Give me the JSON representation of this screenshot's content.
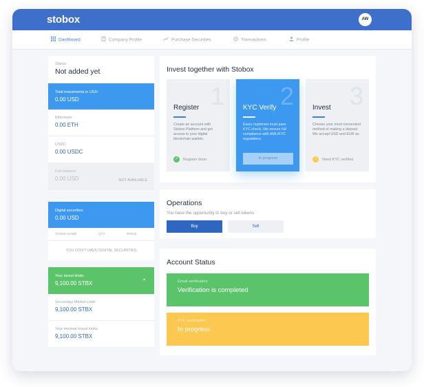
{
  "header": {
    "logo": "stobox",
    "avatar": "AW"
  },
  "nav": [
    {
      "label": "Dashboard",
      "icon": "grid-icon",
      "active": true
    },
    {
      "label": "Company Profile",
      "icon": "building-icon",
      "active": false
    },
    {
      "label": "Purchase Securities",
      "icon": "chart-icon",
      "active": false
    },
    {
      "label": "Transactions",
      "icon": "exchange-icon",
      "active": false
    },
    {
      "label": "Profile",
      "icon": "user-icon",
      "active": false
    }
  ],
  "left": {
    "status": {
      "label": "Status:",
      "value": "Not added yet"
    },
    "total": {
      "label": "Total investments in USD:",
      "value": "0.00 USD"
    },
    "eth": {
      "label": "Ethereum:",
      "value": "0.00 ETH"
    },
    "usdc": {
      "label": "USDC:",
      "value": "0.00 USDC"
    },
    "fiat": {
      "label": "Fiat balance:",
      "value": "0.00 USD",
      "tag": "NOT AVAILABLE"
    },
    "digital": {
      "label": "Digital securities:",
      "value": "0.00 USD"
    },
    "table": {
      "col1": "TOKEN NAME",
      "col2": "QTY",
      "col3": "PRICE",
      "empty": "YOU DON'T HAVE DIGITAL SECURITIES"
    },
    "limits": {
      "label": "Your invest limits:",
      "value": "9,100.00 STBX"
    },
    "secondary": {
      "label": "Secondary Market Limit:",
      "value": "9,100.00 STBX"
    },
    "minimal": {
      "label": "Your minimal invest limits:",
      "value": "9,100.00 STBX"
    }
  },
  "invest": {
    "title": "Invest together with Stobox",
    "steps": [
      {
        "num": "1",
        "title": "Register",
        "desc": "Create an account with Stobox Platform and get access to your digital blockchain wallets.",
        "foot": "Register done"
      },
      {
        "num": "2",
        "title": "KYC Verify",
        "desc": "Every registrant must pass KYC check. We ensure full compliance with AML/KYC regulations.",
        "button": "In progress"
      },
      {
        "num": "3",
        "title": "Invest",
        "desc": "Choose your most convenient method of making a deposit. We accept USD and EUR as",
        "foot": "Need KYC verified"
      }
    ]
  },
  "operations": {
    "title": "Operations",
    "subtitle": "You have the opportunity to buy or sell tokens",
    "buy": "Buy",
    "sell": "Sell"
  },
  "account": {
    "title": "Account Status",
    "email": {
      "label": "Email verification",
      "value": "Verification is completed"
    },
    "kyc": {
      "label": "KYC verification",
      "value": "In progress"
    }
  },
  "colors": {
    "brand": "#3d6fcb",
    "accent_blue": "#3d98f0",
    "success": "#5bc46a",
    "warning": "#fcc850"
  }
}
